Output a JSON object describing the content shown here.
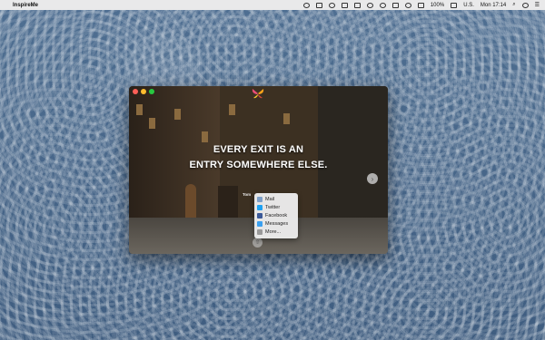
{
  "menubar": {
    "apple_glyph": "",
    "app_name": "InspireMe",
    "battery": "100%",
    "input_source": "U.S.",
    "clock": "Mon 17:14"
  },
  "window": {
    "quote_line1": "EVERY EXIT IS AN",
    "quote_line2": "ENTRY SOMEWHERE ELSE.",
    "author": "Tom",
    "next_glyph": "›"
  },
  "share_menu": {
    "items": [
      {
        "label": "Mail",
        "icon": "mail-icon",
        "color": "#7d9fc8"
      },
      {
        "label": "Twitter",
        "icon": "twitter-icon",
        "color": "#1da1f2"
      },
      {
        "label": "Facebook",
        "icon": "facebook-icon",
        "color": "#3b5998"
      },
      {
        "label": "Messages",
        "icon": "messages-icon",
        "color": "#3aa0f0"
      },
      {
        "label": "More...",
        "icon": "more-icon",
        "color": "#999999"
      }
    ]
  },
  "colors": {
    "traffic_red": "#fc5f57",
    "traffic_yellow": "#fdbc2e",
    "traffic_green": "#28c840"
  }
}
